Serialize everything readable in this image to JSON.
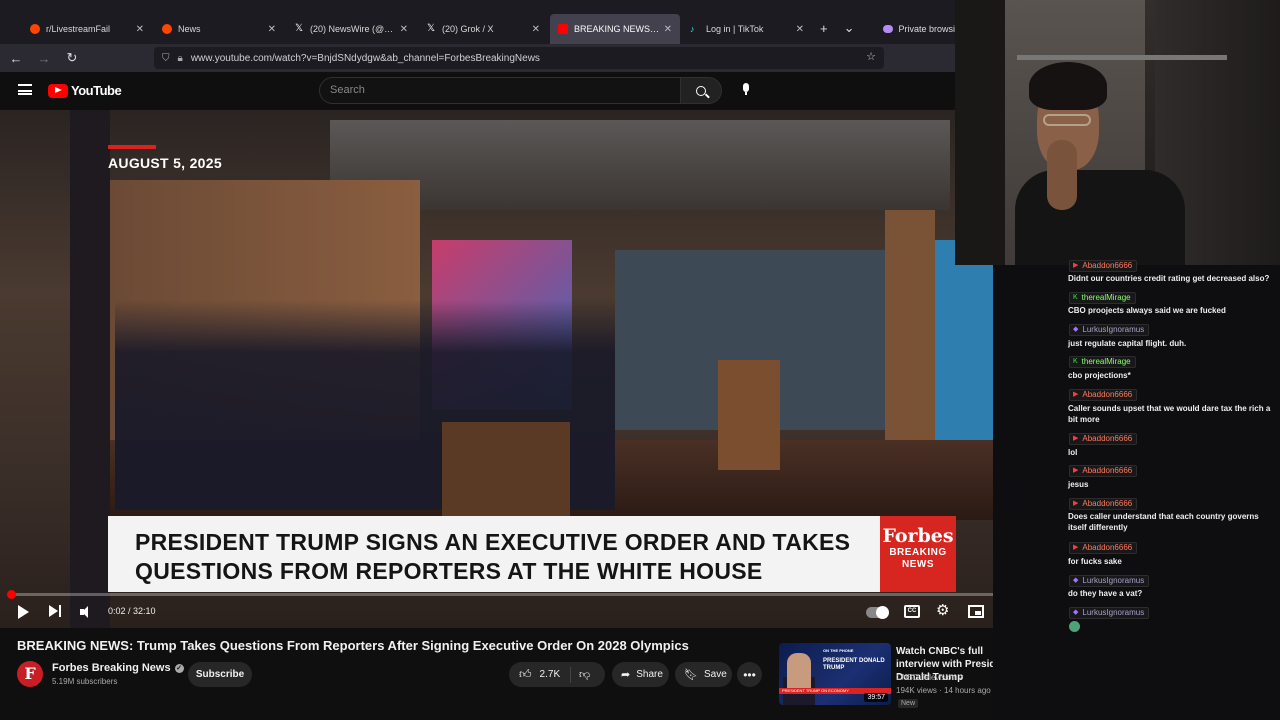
{
  "browser": {
    "tabs": [
      {
        "title": "r/LivestreamFail",
        "fav_color": "#ff4500",
        "active": false
      },
      {
        "title": "News",
        "fav_color": "#ff4500",
        "active": false
      },
      {
        "title": "(20) NewsWire (@NewsW",
        "fav_color": "#ffffff",
        "active": false
      },
      {
        "title": "(20) Grok / X",
        "fav_color": "#ffffff",
        "active": false
      },
      {
        "title": "BREAKING NEWS: Trump",
        "fav_color": "#ff0000",
        "active": true
      },
      {
        "title": "Log in | TikTok",
        "fav_color": "#25f4ee",
        "active": false
      }
    ],
    "new_tab": "+",
    "tab_list": "⌄",
    "private_label": "Private browsi",
    "url": "www.youtube.com/watch?v=BnjdSNdydgw&ab_channel=ForbesBreakingNews"
  },
  "youtube": {
    "logo_text": "YouTube",
    "search_placeholder": "Search"
  },
  "video": {
    "date": "AUGUST 5, 2025",
    "lower_third": {
      "line1": "PRESIDENT TRUMP SIGNS AN EXECUTIVE ORDER AND TAKES",
      "line2": "QUESTIONS FROM REPORTERS AT THE WHITE HOUSE"
    },
    "tag": {
      "brand": "Forbes",
      "line1": "BREAKING",
      "line2": "NEWS"
    },
    "time": "0:02 / 32:10",
    "progress_fraction": 0.001
  },
  "details": {
    "title": "BREAKING NEWS: Trump Takes Questions From Reporters After Signing Executive Order On 2028 Olympics",
    "channel": "Forbes Breaking News",
    "avatar_letter": "F",
    "subscribers": "5.19M subscribers",
    "subscribe": "Subscribe",
    "likes": "2.7K",
    "share": "Share",
    "save": "Save"
  },
  "recommended": {
    "title": "Watch CNBC's full interview with President Donald Trump",
    "channel": "CNBC Television",
    "meta": "194K views · 14 hours ago",
    "badge": "New",
    "duration": "39:57",
    "thumb_top": "ON THE PHONE",
    "thumb_title": "PRESIDENT DONALD TRUMP",
    "thumb_strip": "PRESIDENT TRUMP ON ECONOMY"
  },
  "chat": [
    {
      "user": "Abaddon6666",
      "badge": "red",
      "text": "Didnt our countries credit rating get decreased also?"
    },
    {
      "user": "therealMirage",
      "badge": "green",
      "text": "CBO proojects always said we are fucked"
    },
    {
      "user": "LurkusIgnoramus",
      "badge": "purple",
      "text": "just regulate capital flight. duh."
    },
    {
      "user": "therealMirage",
      "badge": "green",
      "text": "cbo projections*"
    },
    {
      "user": "Abaddon6666",
      "badge": "red",
      "text": "Caller sounds upset that we would dare tax the rich a bit more"
    },
    {
      "user": "Abaddon6666",
      "badge": "red",
      "text": "lol"
    },
    {
      "user": "Abaddon6666",
      "badge": "red",
      "text": "jesus"
    },
    {
      "user": "Abaddon6666",
      "badge": "red",
      "text": "Does caller understand that each country governs itself differently"
    },
    {
      "user": "Abaddon6666",
      "badge": "red",
      "text": "for fucks sake"
    },
    {
      "user": "LurkusIgnoramus",
      "badge": "purple",
      "text": "do they have a vat?"
    },
    {
      "user": "LurkusIgnoramus",
      "badge": "purple",
      "text": ""
    }
  ]
}
